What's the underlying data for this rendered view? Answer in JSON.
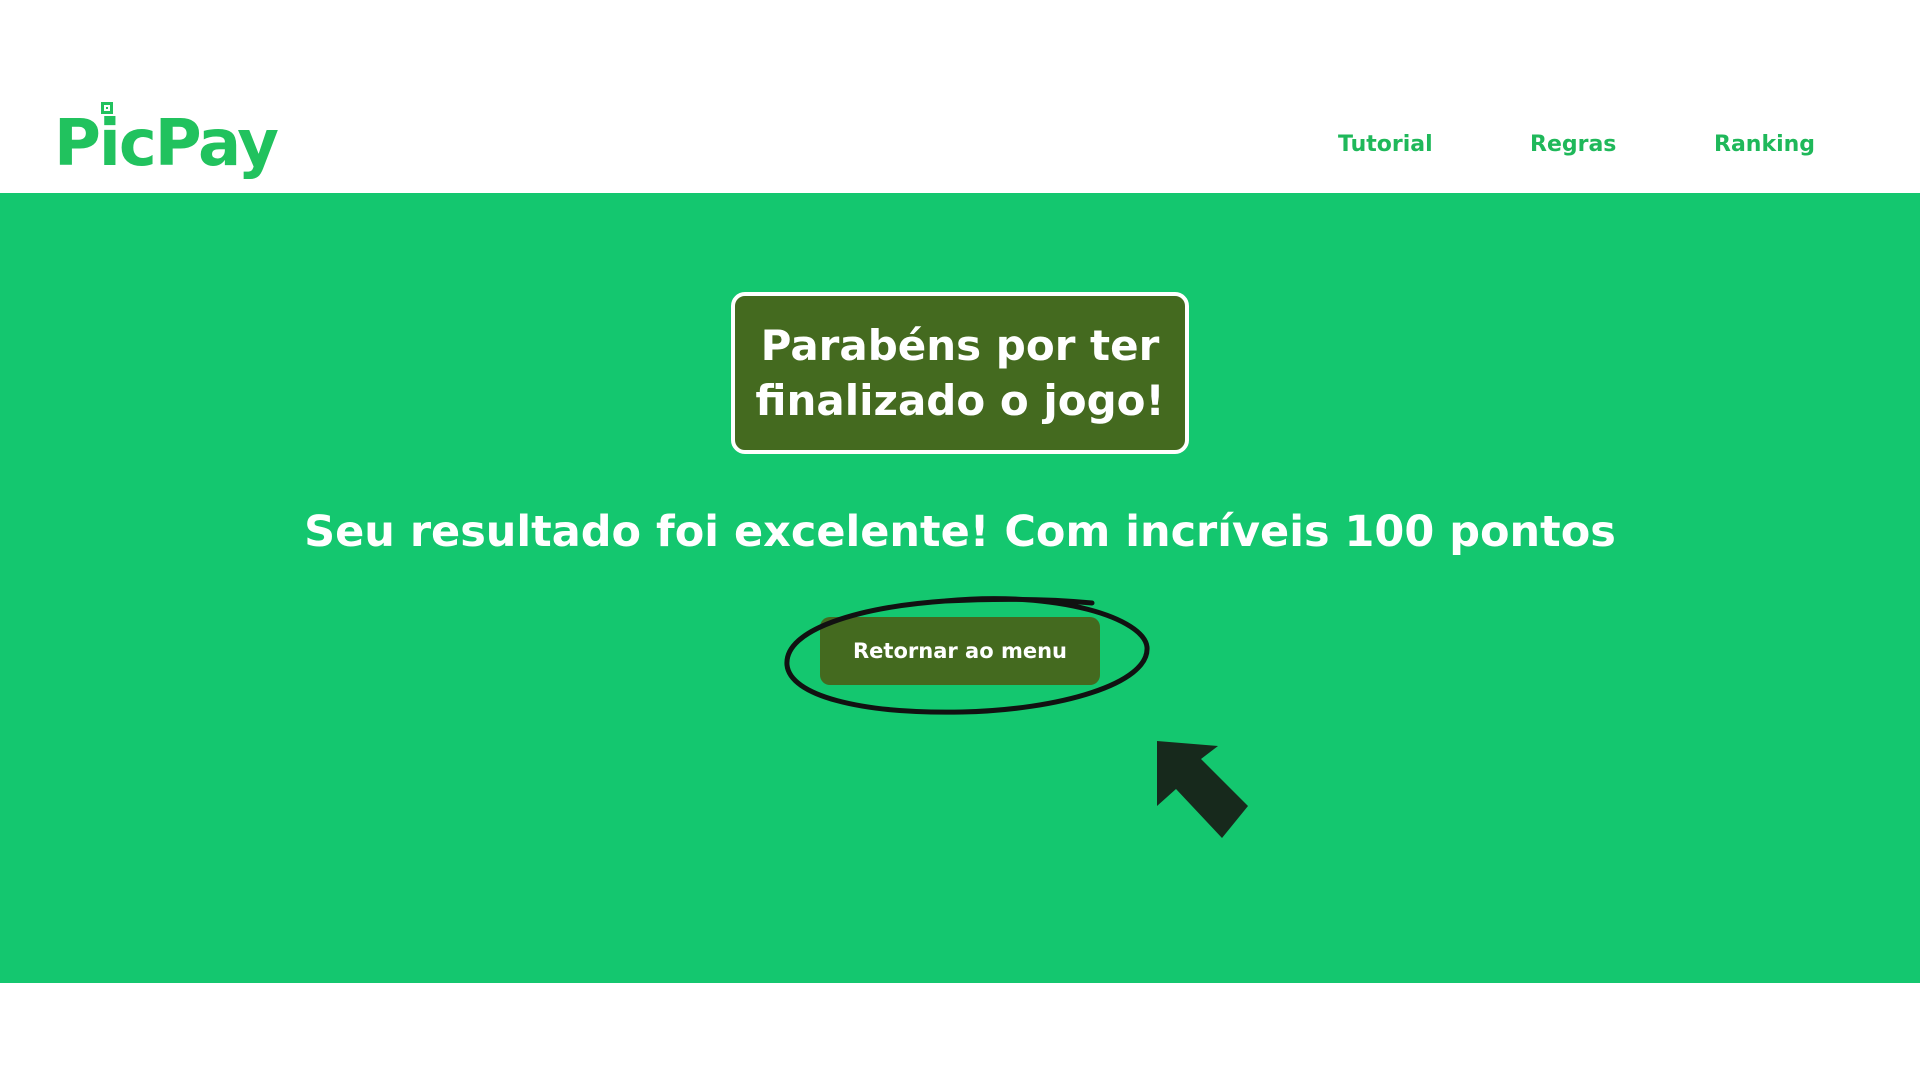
{
  "header": {
    "logo_text": "PicPay",
    "nav": {
      "tutorial": "Tutorial",
      "regras": "Regras",
      "ranking": "Ranking"
    }
  },
  "main": {
    "title": "Parabéns por ter finalizado o jogo!",
    "result": "Seu resultado foi excelente! Com incríveis 100 pontos",
    "menu_button": "Retornar ao menu"
  },
  "colors": {
    "brand": "#21c25e",
    "hero_background": "#14c76f",
    "panel": "#446a1f",
    "text_light": "#ffffff",
    "annotation": "#111111",
    "arrow": "#17291c"
  },
  "icons": {
    "logo_mark": "qr-square-icon",
    "annotation_circle": "highlight-ellipse-icon",
    "annotation_arrow": "pointer-arrow-icon"
  }
}
